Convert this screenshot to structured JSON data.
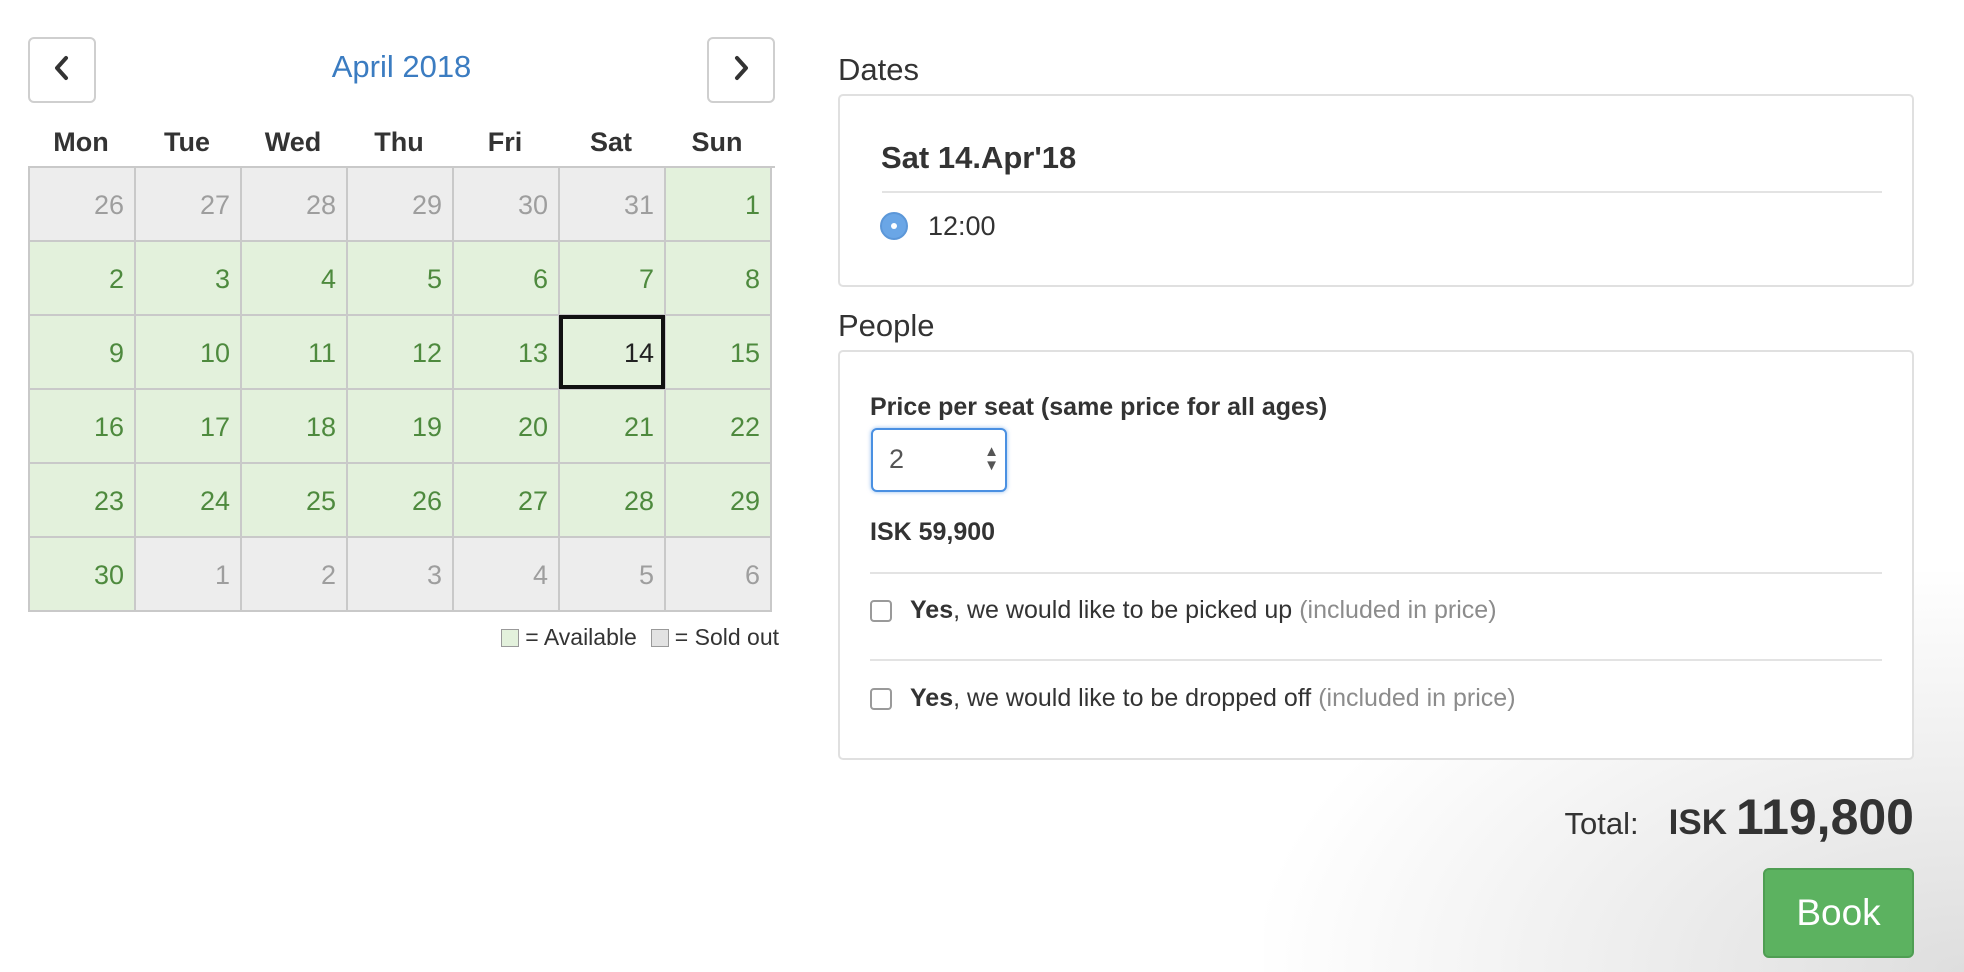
{
  "calendar": {
    "month_title": "April 2018",
    "prev_icon": "chevron-left-icon",
    "next_icon": "chevron-right-icon",
    "weekdays": [
      "Mon",
      "Tue",
      "Wed",
      "Thu",
      "Fri",
      "Sat",
      "Sun"
    ],
    "days": [
      {
        "label": "26",
        "status": "soldout"
      },
      {
        "label": "27",
        "status": "soldout"
      },
      {
        "label": "28",
        "status": "soldout"
      },
      {
        "label": "29",
        "status": "soldout"
      },
      {
        "label": "30",
        "status": "soldout"
      },
      {
        "label": "31",
        "status": "soldout"
      },
      {
        "label": "1",
        "status": "available"
      },
      {
        "label": "2",
        "status": "available"
      },
      {
        "label": "3",
        "status": "available"
      },
      {
        "label": "4",
        "status": "available"
      },
      {
        "label": "5",
        "status": "available"
      },
      {
        "label": "6",
        "status": "available"
      },
      {
        "label": "7",
        "status": "available"
      },
      {
        "label": "8",
        "status": "available"
      },
      {
        "label": "9",
        "status": "available"
      },
      {
        "label": "10",
        "status": "available"
      },
      {
        "label": "11",
        "status": "available"
      },
      {
        "label": "12",
        "status": "available"
      },
      {
        "label": "13",
        "status": "available"
      },
      {
        "label": "14",
        "status": "available",
        "selected": true
      },
      {
        "label": "15",
        "status": "available"
      },
      {
        "label": "16",
        "status": "available"
      },
      {
        "label": "17",
        "status": "available"
      },
      {
        "label": "18",
        "status": "available"
      },
      {
        "label": "19",
        "status": "available"
      },
      {
        "label": "20",
        "status": "available"
      },
      {
        "label": "21",
        "status": "available"
      },
      {
        "label": "22",
        "status": "available"
      },
      {
        "label": "23",
        "status": "available"
      },
      {
        "label": "24",
        "status": "available"
      },
      {
        "label": "25",
        "status": "available"
      },
      {
        "label": "26",
        "status": "available"
      },
      {
        "label": "27",
        "status": "available"
      },
      {
        "label": "28",
        "status": "available"
      },
      {
        "label": "29",
        "status": "available"
      },
      {
        "label": "30",
        "status": "available"
      },
      {
        "label": "1",
        "status": "soldout"
      },
      {
        "label": "2",
        "status": "soldout"
      },
      {
        "label": "3",
        "status": "soldout"
      },
      {
        "label": "4",
        "status": "soldout"
      },
      {
        "label": "5",
        "status": "soldout"
      },
      {
        "label": "6",
        "status": "soldout"
      }
    ],
    "legend": {
      "available_label": "= Available",
      "soldout_label": "= Sold out"
    },
    "colors": {
      "available_bg": "#e3f1dc",
      "available_text": "#4e8a3e",
      "soldout_bg": "#ededed",
      "soldout_text": "#9e9e9e",
      "title": "#3b7cc1"
    }
  },
  "dates": {
    "title": "Dates",
    "selected_date": "Sat 14.Apr'18",
    "time_slot": "12:00"
  },
  "people": {
    "title": "People",
    "price_label": "Price per seat (same price for all ages)",
    "seat_count": "2",
    "seat_price": "ISK 59,900",
    "pickup": {
      "yes": "Yes",
      "text": ", we would like to be picked up",
      "note": "(included in price)",
      "checked": false
    },
    "dropoff": {
      "yes": "Yes",
      "text": ", we would like to be dropped off",
      "note": "(included in price)",
      "checked": false
    }
  },
  "total": {
    "label": "Total:",
    "currency": "ISK",
    "amount": "119,800"
  },
  "book_label": "Book",
  "accent_colors": {
    "book": "#5cb260",
    "focus": "#4a90e2"
  }
}
